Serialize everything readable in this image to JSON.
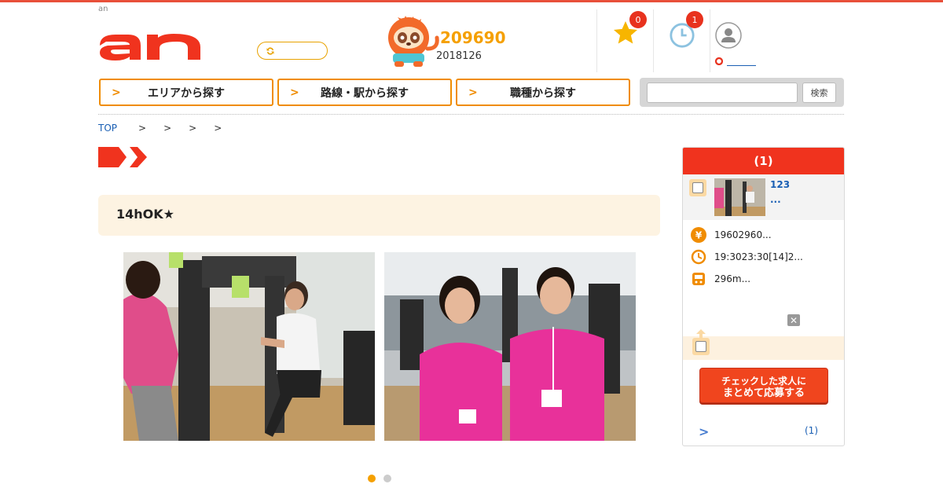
{
  "header": {
    "brand_small": "an",
    "counter": {
      "value": "209690",
      "date": "2018126"
    },
    "favorites": {
      "badge": "0"
    },
    "history": {
      "badge": "1"
    }
  },
  "nav": {
    "area_label": "エリアから探す",
    "route_label": "路線・駅から探す",
    "job_type_label": "職種から探す",
    "search_button": "検索",
    "search_placeholder": ""
  },
  "breadcrumb": {
    "top": "TOP",
    "separators": [
      ">",
      ">",
      ">",
      ">"
    ]
  },
  "main": {
    "title": "14hOK★",
    "carousel": {
      "slides": 2,
      "active_index": 0
    }
  },
  "side_panel": {
    "header": "(1)",
    "job": {
      "title_line1": "123",
      "title_line2": "..."
    },
    "salary": "19602960...",
    "hours": "19:3023:30[14]2...",
    "access": "296m...",
    "apply_button_line1": "チェックした求人に",
    "apply_button_line2": "まとめて応募する",
    "footer_count": "(1)"
  },
  "colors": {
    "brand_red": "#f0331e",
    "accent_orange": "#f08c00",
    "counter_orange": "#f5a000",
    "badge_red": "#e8321e",
    "link_blue": "#1a5fb4"
  }
}
